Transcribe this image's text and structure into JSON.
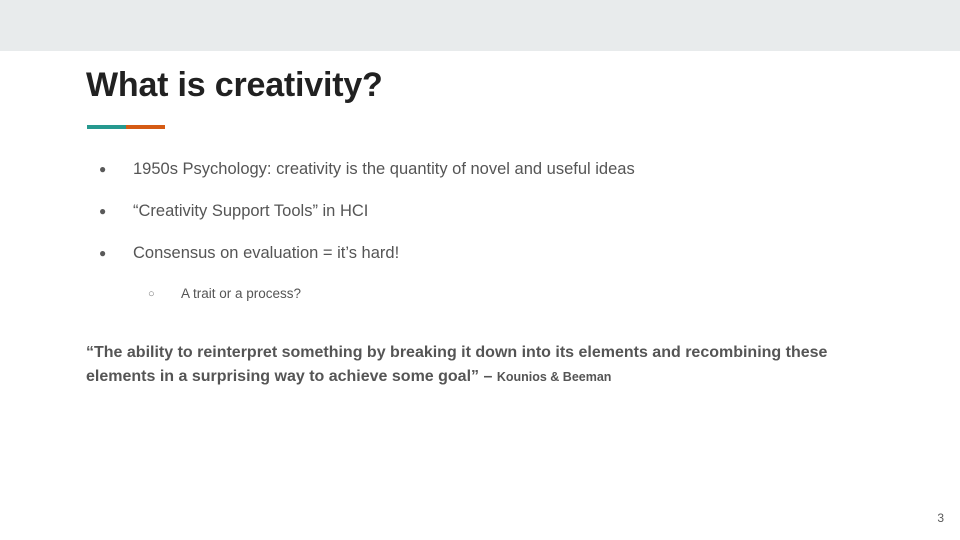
{
  "slide": {
    "title": "What is creativity?",
    "bullets": [
      "1950s Psychology: creativity is the quantity of novel and useful ideas",
      "“Creativity Support Tools” in HCI",
      "Consensus on evaluation = it’s hard!"
    ],
    "sub_bullets": [
      "A trait or a process?"
    ],
    "bullet_glyph": "●",
    "sub_bullet_glyph": "○",
    "quote": {
      "text": "“The ability to reinterpret something by breaking it down into its elements and recombining these elements in a surprising way to achieve some goal” –",
      "attribution": "Kounios & Beeman"
    },
    "page_number": "3"
  },
  "colors": {
    "top_band": "#e8ebec",
    "accent_teal": "#26998f",
    "accent_orange": "#d55b14",
    "title": "#212121",
    "body_text": "#555555"
  }
}
